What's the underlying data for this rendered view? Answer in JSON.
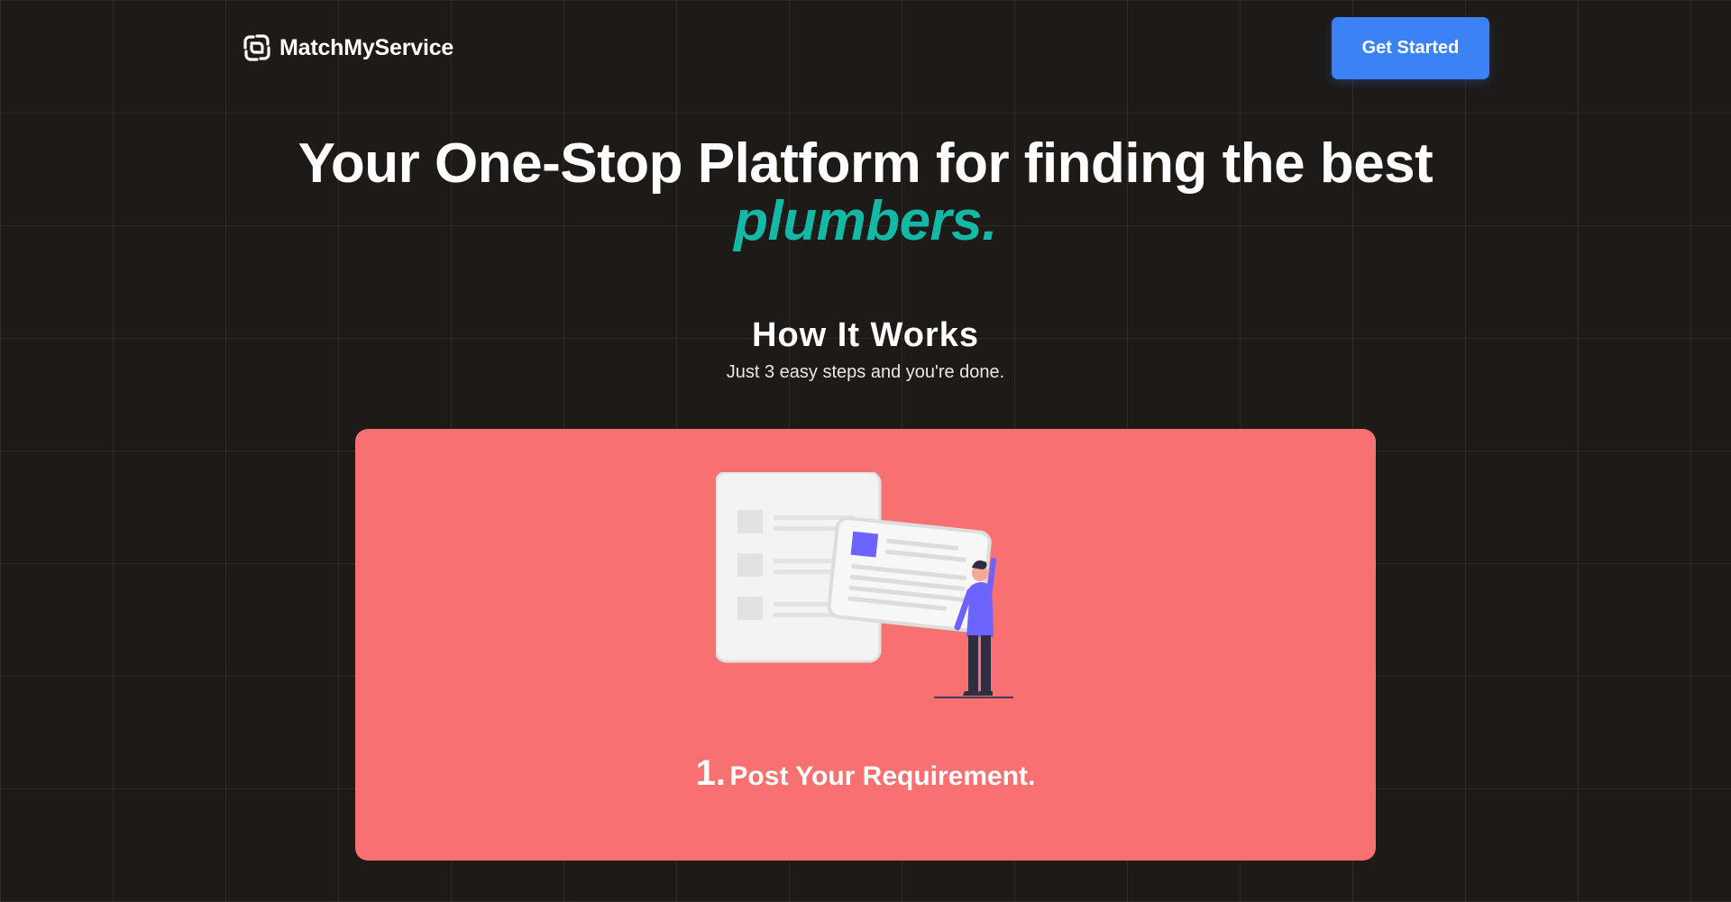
{
  "navbar": {
    "brand_name": "MatchMyService",
    "brand_icon": "service-knot-icon",
    "cta_label": "Get Started",
    "cta_color": "#3b82f6"
  },
  "hero": {
    "title": "Your One-Stop Platform for finding the best",
    "highlight": "plumbers.",
    "highlight_color": "#14b8a6"
  },
  "how_it_works": {
    "title": "How It Works",
    "subtitle": "Just 3 easy steps and you're done."
  },
  "steps": [
    {
      "number": "1.",
      "label": "Post Your Requirement.",
      "illustration": "person-holding-document-illustration",
      "card_color": "#f87171"
    }
  ],
  "colors": {
    "background": "#1d1a18",
    "accent_purple": "#6c63ff"
  }
}
